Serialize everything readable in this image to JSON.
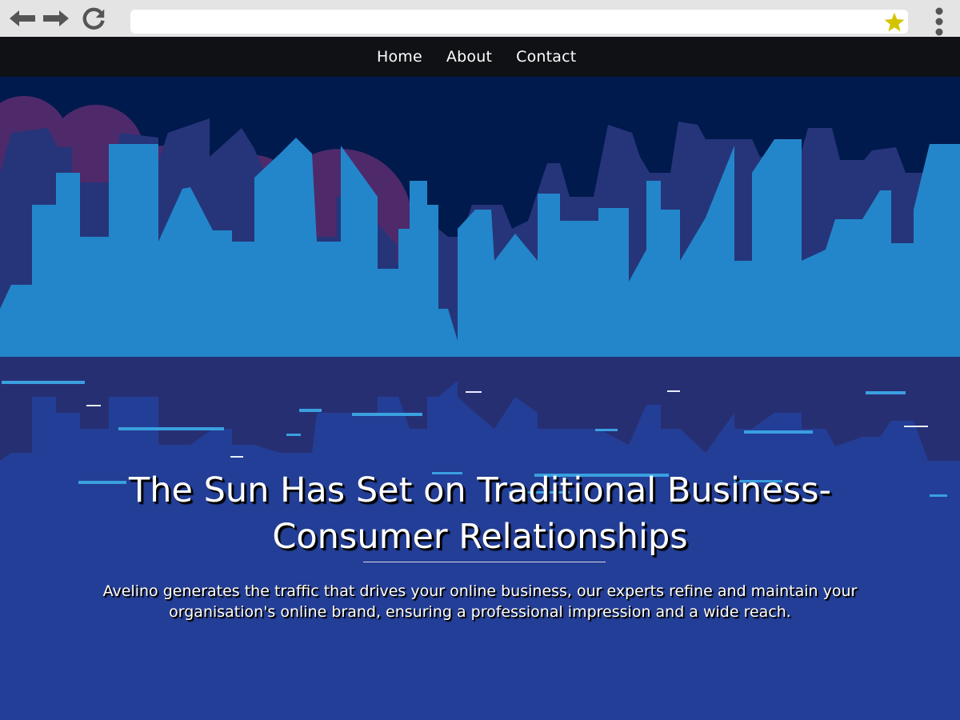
{
  "browser": {
    "address_value": "",
    "icons": {
      "back": "arrow-left-icon",
      "forward": "arrow-right-icon",
      "reload": "reload-icon",
      "bookmark": "star-icon",
      "menu": "vertical-dots-icon"
    },
    "colors": {
      "chrome": "#e4e4e4",
      "icon": "#555555",
      "star": "#d4c400"
    }
  },
  "nav": {
    "items": [
      {
        "label": "Home"
      },
      {
        "label": "About"
      },
      {
        "label": "Contact"
      }
    ],
    "colors": {
      "background": "#0f1115",
      "text": "#ffffff"
    }
  },
  "hero": {
    "title": "The Sun Has Set on Traditional Business-Consumer Relationships",
    "subtitle": "Avelino generates the traffic that drives your online business, our experts refine and maintain your organisation's online brand, ensuring a professional impression and a wide reach.",
    "colors": {
      "sky": "#001a4d",
      "sun": "#4e2a6b",
      "back_city": "#26357a",
      "front_city": "#2386ca",
      "water": "#233e96",
      "reflection": "#272f73",
      "streak": "#3aa0e0"
    }
  }
}
